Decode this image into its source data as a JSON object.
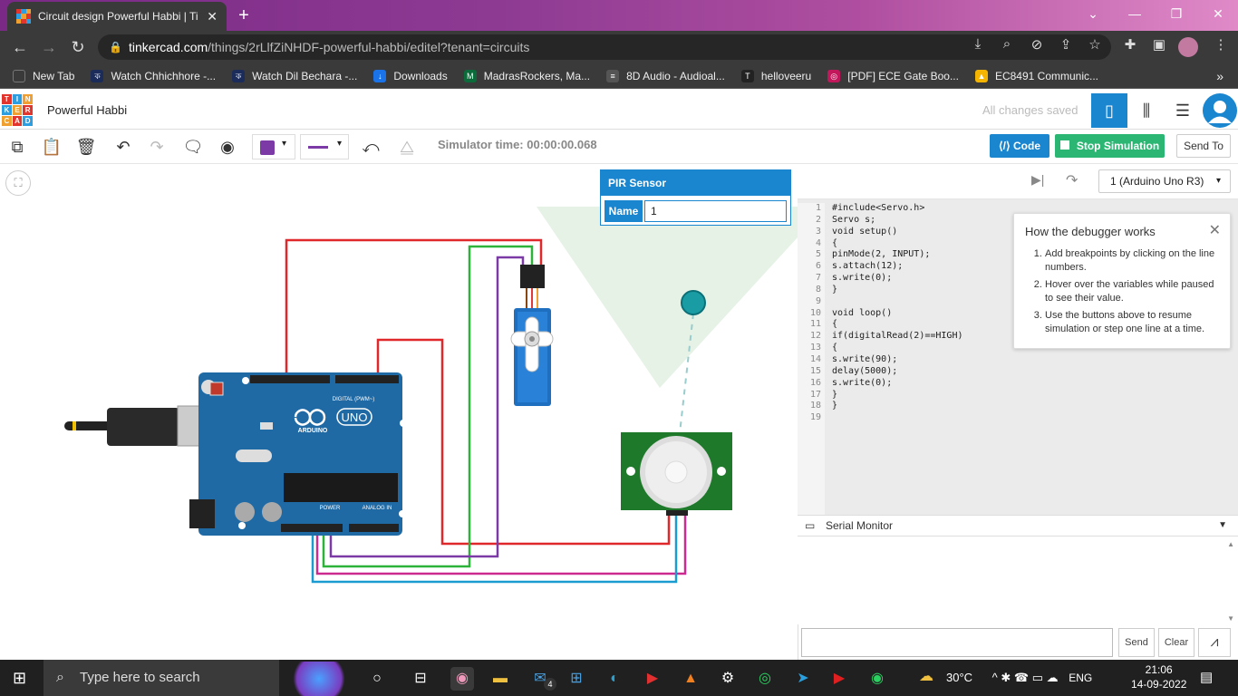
{
  "browser": {
    "tab_title": "Circuit design Powerful Habbi | Ti",
    "url_host": "tinkercad.com",
    "url_path": "/things/2rLlfZiNHDF-powerful-habbi/editel?tenant=circuits",
    "bookmarks": [
      {
        "label": "New Tab",
        "color": "#3a3a3a",
        "glyph": ""
      },
      {
        "label": "Watch Chhichhore -...",
        "color": "#1c2c5a",
        "glyph": "ক"
      },
      {
        "label": "Watch Dil Bechara -...",
        "color": "#1c2c5a",
        "glyph": "ক"
      },
      {
        "label": "Downloads",
        "color": "#1a73e8",
        "glyph": "↓"
      },
      {
        "label": "MadrasRockers, Ma...",
        "color": "#0b6b3a",
        "glyph": "M"
      },
      {
        "label": "8D Audio - Audioal...",
        "color": "#555555",
        "glyph": "≡"
      },
      {
        "label": "helloveeru",
        "color": "#222222",
        "glyph": "T"
      },
      {
        "label": "[PDF] ECE Gate Boo...",
        "color": "#c2185b",
        "glyph": "◎"
      },
      {
        "label": "EC8491 Communic...",
        "color": "#f4b400",
        "glyph": "▲"
      }
    ]
  },
  "app": {
    "logo_letters": [
      "T",
      "I",
      "N",
      "K",
      "E",
      "R",
      "C",
      "A",
      "D"
    ],
    "project_name": "Powerful Habbi",
    "save_status": "All changes saved",
    "simulator_time": "Simulator time: 00:00:00.068",
    "code_label": "Code",
    "stop_label": "Stop Simulation",
    "send_to_label": "Send To"
  },
  "pir_popup": {
    "title": "PIR Sensor",
    "name_label": "Name",
    "name_value": "1"
  },
  "debugger": {
    "board_select": "1 (Arduino Uno R3)",
    "line_numbers": [
      "1",
      "2",
      "3",
      "4",
      "5",
      "6",
      "7",
      "8",
      "9",
      "10",
      "11",
      "12",
      "13",
      "14",
      "15",
      "16",
      "17",
      "18",
      "19"
    ],
    "code_lines": [
      "#include<Servo.h>",
      "Servo s;",
      "void setup()",
      "{",
      "pinMode(2, INPUT);",
      "s.attach(12);",
      "s.write(0);",
      "}",
      "",
      "void loop()",
      "{",
      "if(digitalRead(2)==HIGH)",
      "{",
      "s.write(90);",
      "delay(5000);",
      "s.write(0);",
      "}",
      "}",
      ""
    ],
    "help_title": "How the debugger works",
    "help_items": [
      "Add breakpoints by clicking on the line numbers.",
      "Hover over the variables while paused to see their value.",
      "Use the buttons above to resume simulation or step one line at a time."
    ]
  },
  "serial": {
    "title": "Serial Monitor",
    "send_label": "Send",
    "clear_label": "Clear"
  },
  "board": {
    "brand": "ARDUINO",
    "model": "UNO",
    "digital_label": "DIGITAL (PWM~)",
    "power_label": "POWER",
    "analog_label": "ANALOG IN"
  },
  "taskbar": {
    "search_placeholder": "Type here to search",
    "temperature": "30°C",
    "language": "ENG",
    "time": "21:06",
    "date": "14-09-2022",
    "mail_badge": "4"
  }
}
